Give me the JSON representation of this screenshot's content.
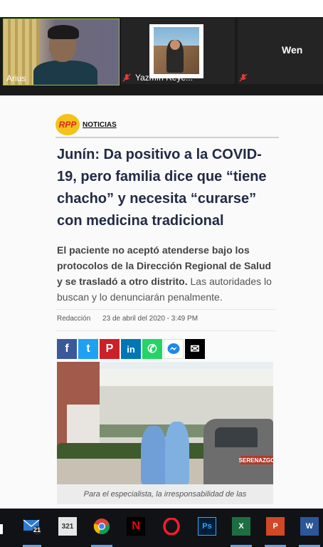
{
  "zoom": {
    "participants": [
      {
        "name": "Arius",
        "active_speaker": true
      },
      {
        "name": "Yazmín Reye...",
        "muted": true
      },
      {
        "name": "Wen",
        "muted": true
      }
    ]
  },
  "article": {
    "logo_badge": "RPP",
    "logo_section": "NOTICIAS",
    "headline": "Junín: Da positivo a la COVID-19, pero familia dice que “tiene chacho” y necesita “curarse” con medicina tradicional",
    "summary_bold": "El paciente no aceptó atenderse bajo los protocolos de la Dirección Regional de Salud y se trasladó a otro distrito.",
    "summary_rest": " Las autoridades lo buscan y lo denunciarán penalmente.",
    "author": "Redacción",
    "date": "23 de abril del 2020 - 3:49 PM",
    "share_buttons": [
      {
        "name": "facebook",
        "glyph": "f"
      },
      {
        "name": "twitter",
        "glyph": "t"
      },
      {
        "name": "pinterest",
        "glyph": "P"
      },
      {
        "name": "linkedin",
        "glyph": "in"
      },
      {
        "name": "whatsapp",
        "glyph": "✆"
      },
      {
        "name": "messenger",
        "glyph": "⚡"
      },
      {
        "name": "email",
        "glyph": "✉"
      }
    ],
    "photo_sign": "SERENAZGO",
    "photo_caption": "Para el especialista, la irresponsabilidad de las"
  },
  "taskbar": {
    "mail_badge": "21",
    "calendar_label": "321",
    "apps": [
      "mail",
      "calendar",
      "chrome",
      "netflix",
      "opera",
      "photoshop",
      "excel",
      "powerpoint",
      "word"
    ],
    "ps_label": "Ps",
    "x_label": "X",
    "p_label": "P",
    "w_label": "W"
  },
  "colors": {
    "headline": "#222a44",
    "rpp_yellow": "#f4c21b",
    "rpp_red": "#e0261a",
    "zoom_bg": "#1a1a1a",
    "taskbar_bg": "#111216"
  }
}
